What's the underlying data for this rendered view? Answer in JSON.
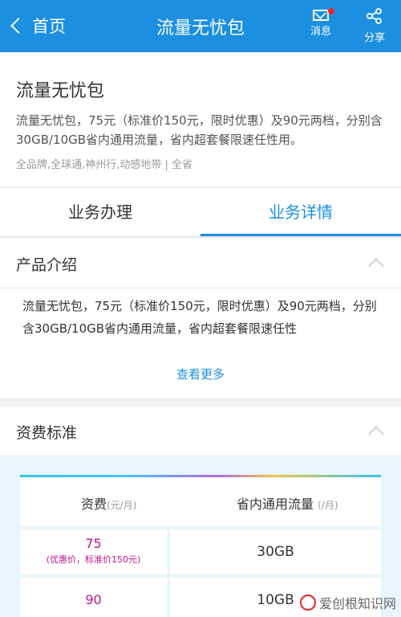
{
  "topbar": {
    "back_label": "首页",
    "title": "流量无忧包",
    "messages_label": "消息",
    "share_label": "分享",
    "bg_color": "#1c8fe0"
  },
  "product": {
    "title": "流量无忧包",
    "description": "流量无忧包，75元（标准价150元，限时优惠）及90元两档，分别含30GB/10GB省内通用流量，省内超套餐限速任性用。",
    "tags": "全品牌,全球通,神州行,动感地带 | 全省"
  },
  "tabs": [
    {
      "label": "业务办理",
      "active": false
    },
    {
      "label": "业务详情",
      "active": true
    }
  ],
  "intro_section": {
    "title": "产品介绍",
    "body": "流量无忧包，75元（标准价150元，限时优惠）及90元两档，分别含30GB/10GB省内通用流量，省内超套餐限速任性",
    "see_more": "查看更多"
  },
  "fee_section": {
    "title": "资费标准",
    "columns": [
      {
        "label": "资费",
        "unit": "(元/月)"
      },
      {
        "label": "省内通用流量",
        "unit": "(/月)"
      }
    ],
    "rows": [
      {
        "price": "75",
        "note": "(优惠价，标准价150元)",
        "data": "30GB"
      },
      {
        "price": "90",
        "note": "",
        "data": "10GB"
      }
    ]
  },
  "watermark": "爱创根知识网"
}
